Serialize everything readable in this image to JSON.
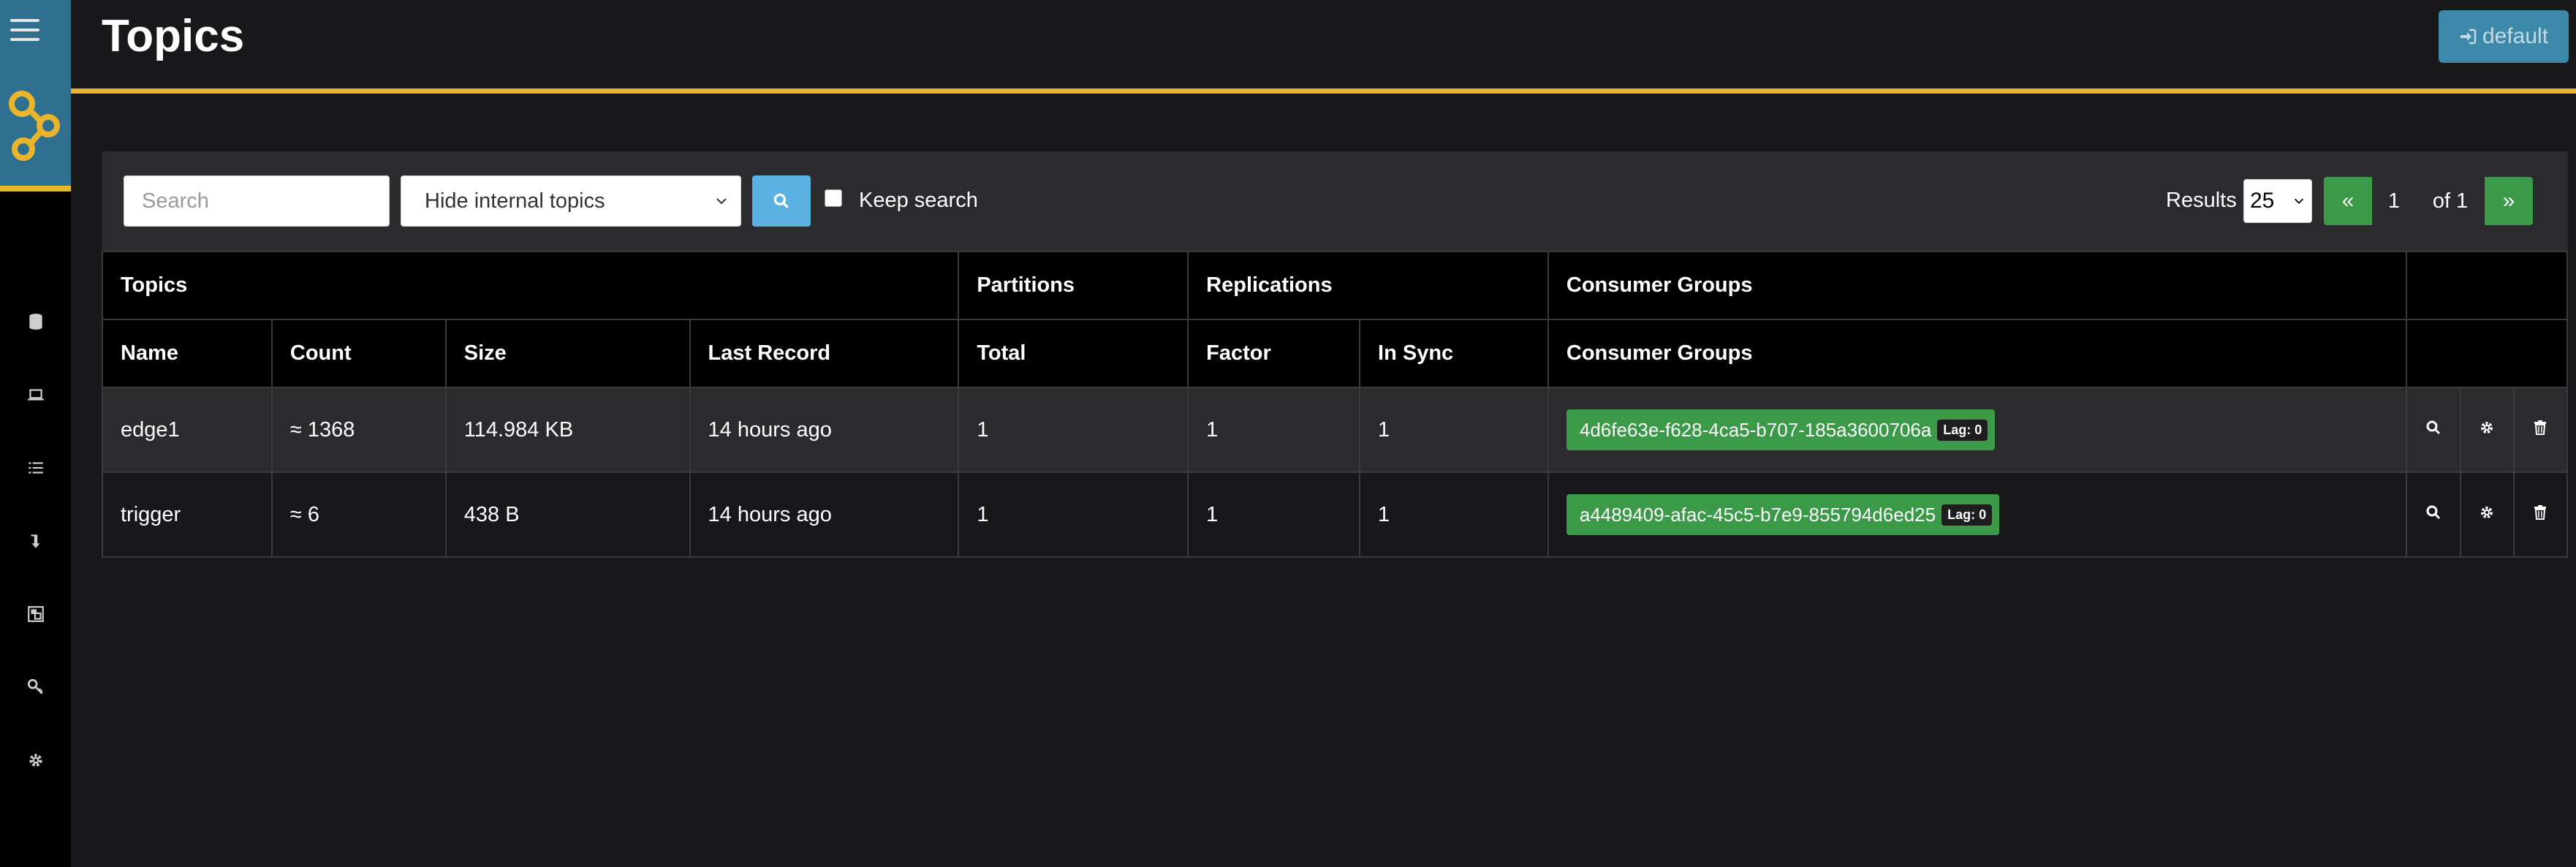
{
  "header": {
    "title": "Topics",
    "login_label": "default"
  },
  "sidebar": {
    "items": [
      {
        "icon": "database-icon"
      },
      {
        "icon": "laptop-icon"
      },
      {
        "icon": "list-icon"
      },
      {
        "icon": "level-down-icon"
      },
      {
        "icon": "object-group-icon"
      },
      {
        "icon": "key-icon"
      },
      {
        "icon": "gear-icon"
      }
    ]
  },
  "filters": {
    "search_placeholder": "Search",
    "topic_filter_value": "Hide internal topics",
    "keep_search_label": "Keep search",
    "results_label": "Results",
    "results_value": "25"
  },
  "pagination": {
    "prev": "«",
    "page": "1",
    "of": "of 1",
    "next": "»"
  },
  "table": {
    "group_headers": [
      "Topics",
      "Partitions",
      "Replications",
      "Consumer Groups"
    ],
    "columns": [
      "Name",
      "Count",
      "Size",
      "Last Record",
      "Total",
      "Factor",
      "In Sync",
      "Consumer Groups"
    ],
    "rows": [
      {
        "name": "edge1",
        "count": "≈ 1368",
        "size": "114.984 KB",
        "last_record": "14 hours ago",
        "total": "1",
        "factor": "1",
        "in_sync": "1",
        "consumer_group": "4d6fe63e-f628-4ca5-b707-185a3600706a",
        "lag": "Lag: 0"
      },
      {
        "name": "trigger",
        "count": "≈ 6",
        "size": "438 B",
        "last_record": "14 hours ago",
        "total": "1",
        "factor": "1",
        "in_sync": "1",
        "consumer_group": "a4489409-afac-45c5-b7e9-855794d6ed25",
        "lag": "Lag: 0"
      }
    ]
  },
  "colors": {
    "accent": "#ebb52b",
    "sidebar_top": "#2f6f8f",
    "success": "#3a9a47",
    "info": "#5bb2e2"
  }
}
